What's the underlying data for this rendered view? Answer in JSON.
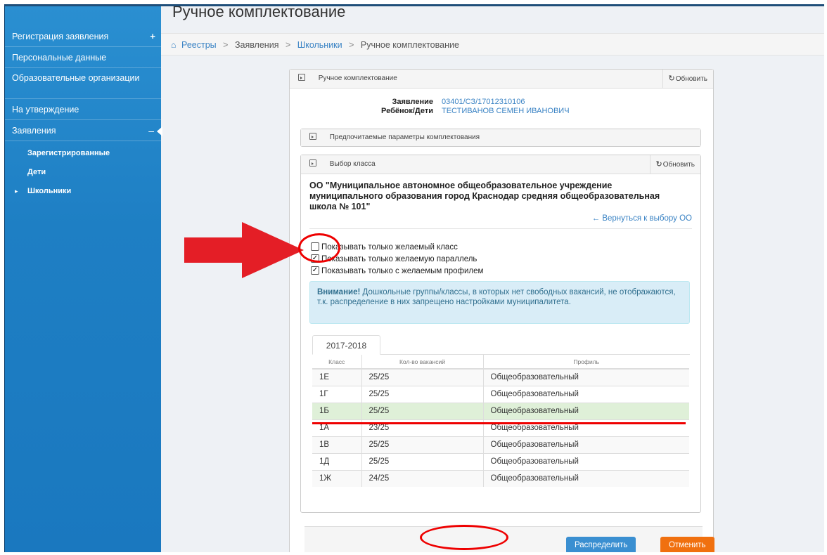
{
  "sidebar": {
    "items": [
      {
        "label": "Регистрация заявления"
      },
      {
        "label": "Персональные данные"
      },
      {
        "label": "Образовательные организации"
      },
      {
        "label": "На утверждение"
      },
      {
        "label": "Заявления"
      }
    ],
    "sub_items": [
      {
        "label": "Зарегистрированные"
      },
      {
        "label": "Дети"
      },
      {
        "label": "Школьники"
      }
    ],
    "plus_symbol": "+",
    "minus_symbol": "–"
  },
  "page": {
    "title": "Ручное комплектование"
  },
  "breadcrumb": {
    "items": [
      "Реестры",
      "Заявления",
      "Школьники"
    ],
    "current": "Ручное комплектование"
  },
  "outer_panel": {
    "title": "Ручное комплектование",
    "refresh_label": "Обновить"
  },
  "application": {
    "label_app": "Заявление",
    "value_app": "03401/СЗ/17012310106",
    "label_child": "Ребёнок/Дети",
    "value_child": "ТЕСТИВАНОВ СЕМЕН ИВАНОВИЧ"
  },
  "pref_panel": {
    "title": "Предпочитаемые параметры комплектования"
  },
  "class_panel": {
    "title": "Выбор класса",
    "refresh_label": "Обновить",
    "org_name": "ОО \"Муниципальное автономное общеобразовательное учреждение муниципального образования город Краснодар средняя общеобразовательная школа № 101\"",
    "back_link": "Вернуться к выбору ОО",
    "checkboxes": [
      {
        "label": "Показывать только желаемый класс",
        "checked": false
      },
      {
        "label": "Показывать только желаемую параллель",
        "checked": true
      },
      {
        "label": "Показывать только с желаемым профилем",
        "checked": true
      }
    ],
    "alert_title": "Внимание!",
    "alert_text": "Дошкольные группы/классы, в которых нет свободных вакансий, не отображаются, т.к. распределение в них запрещено настройками муниципалитета.",
    "year_tab": "2017-2018",
    "table": {
      "headers": [
        "Класс",
        "Кол-во вакансий",
        "Профиль"
      ],
      "rows": [
        [
          "1Е",
          "25/25",
          "Общеобразовательный"
        ],
        [
          "1Г",
          "25/25",
          "Общеобразовательный"
        ],
        [
          "1Б",
          "25/25",
          "Общеобразовательный"
        ],
        [
          "1А",
          "23/25",
          "Общеобразовательный"
        ],
        [
          "1В",
          "25/25",
          "Общеобразовательный"
        ],
        [
          "1Д",
          "25/25",
          "Общеобразовательный"
        ],
        [
          "1Ж",
          "24/25",
          "Общеобразовательный"
        ]
      ]
    }
  },
  "actions": {
    "distribute": "Распределить",
    "cancel": "Отменить"
  },
  "colors": {
    "sidebar": "#2a8fd1",
    "link": "#3a83c4",
    "highlight_row": "#dff0d8",
    "alert_bg": "#d9edf7",
    "btn_primary": "#3a8fd1",
    "btn_cancel": "#f0700f",
    "annotation": "#e00000"
  }
}
